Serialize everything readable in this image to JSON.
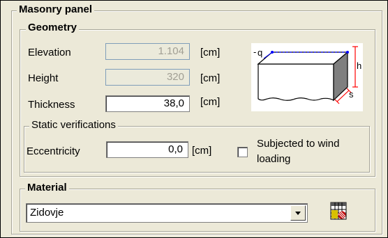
{
  "panel": {
    "title": "Masonry panel"
  },
  "geometry": {
    "title": "Geometry",
    "elevation": {
      "label": "Elevation",
      "value": "1.104",
      "unit": "[cm]"
    },
    "height": {
      "label": "Height",
      "value": "320",
      "unit": "[cm]"
    },
    "thickness": {
      "label": "Thickness",
      "value": "38,0",
      "unit": "[cm]"
    },
    "diagram": {
      "q": "q",
      "h": "h",
      "s": "s"
    }
  },
  "static": {
    "title": "Static verifications",
    "eccentricity": {
      "label": "Eccentricity",
      "value": "0,0",
      "unit": "[cm]"
    },
    "wind": {
      "label_line1": "Subjected to wind",
      "label_line2": "loading",
      "checked": false
    }
  },
  "material": {
    "title": "Material",
    "selected": "Zidovje",
    "icon": "material-database-icon"
  },
  "colors": {
    "background": "#ece9d8",
    "accent": "#ff0000",
    "line": "#0000ff"
  }
}
